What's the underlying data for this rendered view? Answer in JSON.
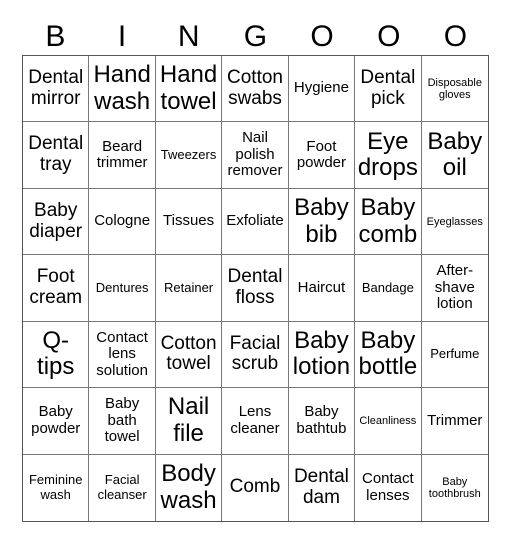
{
  "header": {
    "letters": [
      "B",
      "I",
      "N",
      "G",
      "O",
      "O",
      "O"
    ]
  },
  "board": {
    "rows": [
      [
        {
          "text": "Dental mirror",
          "size": "l"
        },
        {
          "text": "Hand wash",
          "size": "xl"
        },
        {
          "text": "Hand towel",
          "size": "xl"
        },
        {
          "text": "Cotton swabs",
          "size": "l"
        },
        {
          "text": "Hygiene",
          "size": "m"
        },
        {
          "text": "Dental pick",
          "size": "l"
        },
        {
          "text": "Disposable gloves",
          "size": "xs"
        }
      ],
      [
        {
          "text": "Dental tray",
          "size": "l"
        },
        {
          "text": "Beard trimmer",
          "size": "m"
        },
        {
          "text": "Tweezers",
          "size": "s"
        },
        {
          "text": "Nail polish remover",
          "size": "m"
        },
        {
          "text": "Foot powder",
          "size": "m"
        },
        {
          "text": "Eye drops",
          "size": "xl"
        },
        {
          "text": "Baby oil",
          "size": "xl"
        }
      ],
      [
        {
          "text": "Baby diaper",
          "size": "l"
        },
        {
          "text": "Cologne",
          "size": "m"
        },
        {
          "text": "Tissues",
          "size": "m"
        },
        {
          "text": "Exfoliate",
          "size": "m"
        },
        {
          "text": "Baby bib",
          "size": "xl"
        },
        {
          "text": "Baby comb",
          "size": "xl"
        },
        {
          "text": "Eyeglasses",
          "size": "xs"
        }
      ],
      [
        {
          "text": "Foot cream",
          "size": "l"
        },
        {
          "text": "Dentures",
          "size": "s"
        },
        {
          "text": "Retainer",
          "size": "s"
        },
        {
          "text": "Dental floss",
          "size": "l"
        },
        {
          "text": "Haircut",
          "size": "m"
        },
        {
          "text": "Bandage",
          "size": "s"
        },
        {
          "text": "After-shave lotion",
          "size": "m"
        }
      ],
      [
        {
          "text": "Q-tips",
          "size": "xl"
        },
        {
          "text": "Contact lens solution",
          "size": "m"
        },
        {
          "text": "Cotton towel",
          "size": "l"
        },
        {
          "text": "Facial scrub",
          "size": "l"
        },
        {
          "text": "Baby lotion",
          "size": "xl"
        },
        {
          "text": "Baby bottle",
          "size": "xl"
        },
        {
          "text": "Perfume",
          "size": "s"
        }
      ],
      [
        {
          "text": "Baby powder",
          "size": "m"
        },
        {
          "text": "Baby bath towel",
          "size": "m"
        },
        {
          "text": "Nail file",
          "size": "xl"
        },
        {
          "text": "Lens cleaner",
          "size": "m"
        },
        {
          "text": "Baby bathtub",
          "size": "m"
        },
        {
          "text": "Cleanliness",
          "size": "xs"
        },
        {
          "text": "Trimmer",
          "size": "m"
        }
      ],
      [
        {
          "text": "Feminine wash",
          "size": "s"
        },
        {
          "text": "Facial cleanser",
          "size": "s"
        },
        {
          "text": "Body wash",
          "size": "xl"
        },
        {
          "text": "Comb",
          "size": "l"
        },
        {
          "text": "Dental dam",
          "size": "l"
        },
        {
          "text": "Contact lenses",
          "size": "m"
        },
        {
          "text": "Baby toothbrush",
          "size": "xs"
        }
      ]
    ]
  }
}
